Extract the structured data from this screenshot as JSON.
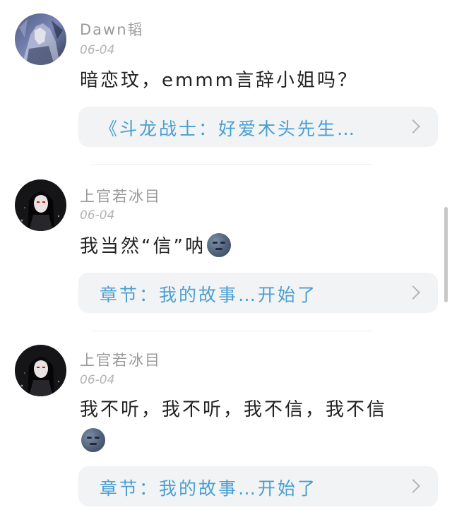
{
  "comments": [
    {
      "username": "Dawn韬",
      "date": "06-04",
      "text": "暗恋玟，emmm言辞小姐吗？",
      "link": "《斗龙战士：好爱木头先生…",
      "avatar": "avatar-icon"
    },
    {
      "username": "上官若冰目",
      "date": "06-04",
      "text": "我当然“信”呐",
      "link": "章节：我的故事…开始了",
      "avatar": "avatar-icon",
      "emoji": "new-moon-face-icon"
    },
    {
      "username": "上官若冰目",
      "date": "06-04",
      "text": "我不听，我不听，我不信，我不信",
      "link": "章节：我的故事…开始了",
      "avatar": "avatar-icon",
      "emoji": "new-moon-face-icon"
    }
  ],
  "icons": {
    "chevron": "chevron-right-icon"
  },
  "colors": {
    "link": "#4a9fd1",
    "card_bg": "#f2f3f5",
    "username": "#9a9a9a"
  }
}
